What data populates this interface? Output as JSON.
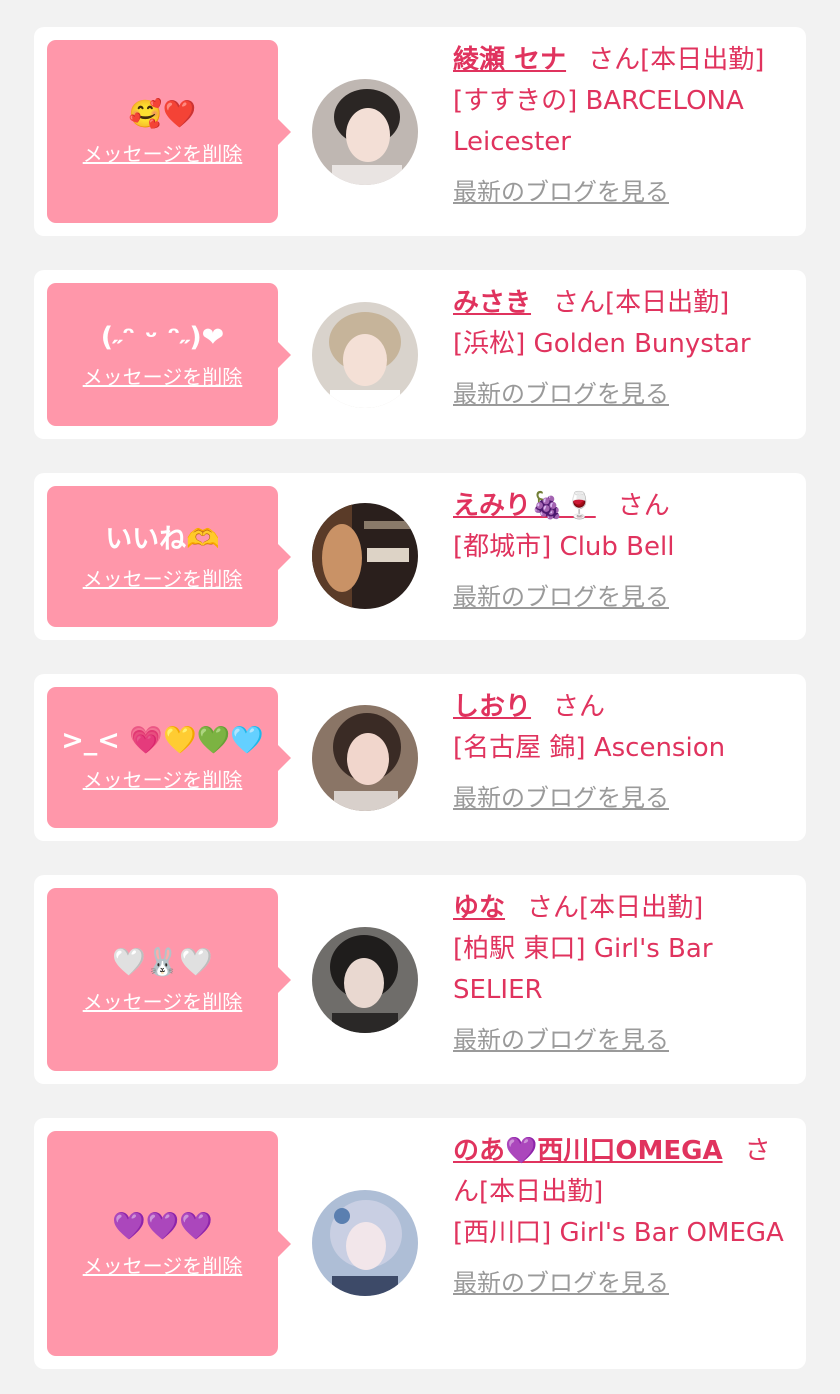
{
  "delete_label": "メッセージを削除",
  "blog_label": "最新のブログを見る",
  "san_label": "さん",
  "accent_color": "#e0335e",
  "bubble_color": "#ff97aa",
  "cards": [
    {
      "message": "🥰❤️",
      "name": "綾瀬 セナ",
      "suffix": "[本日出勤]",
      "shop": "[すすきの] BARCELONA Leicester",
      "avatar": "avatar-photo-woman"
    },
    {
      "message": "(˶ᵔ ᵕ ᵔ˶)❤",
      "name": "みさき",
      "suffix": "[本日出勤]",
      "shop": "[浜松] Golden Bunystar",
      "avatar": "avatar-photo-woman"
    },
    {
      "message": "いいね🫶",
      "name": "えみり🍇🍷",
      "suffix": "",
      "shop": "[都城市] Club Bell",
      "avatar": "avatar-photo-birthday"
    },
    {
      "message": ">_< 💗💛💚🩵",
      "name": "しおり",
      "suffix": "",
      "shop": "[名古屋 錦] Ascension",
      "avatar": "avatar-photo-woman"
    },
    {
      "message": "🤍🐰🤍",
      "name": "ゆな",
      "suffix": "[本日出勤]",
      "shop": "[柏駅 東口] Girl's Bar SELIER",
      "avatar": "avatar-photo-woman"
    },
    {
      "message": "💜💜💜",
      "name": "のあ💜西川口OMEGA",
      "suffix": "[本日出勤]",
      "shop": "[西川口] Girl's Bar OMEGA",
      "avatar": "avatar-illustration"
    }
  ]
}
